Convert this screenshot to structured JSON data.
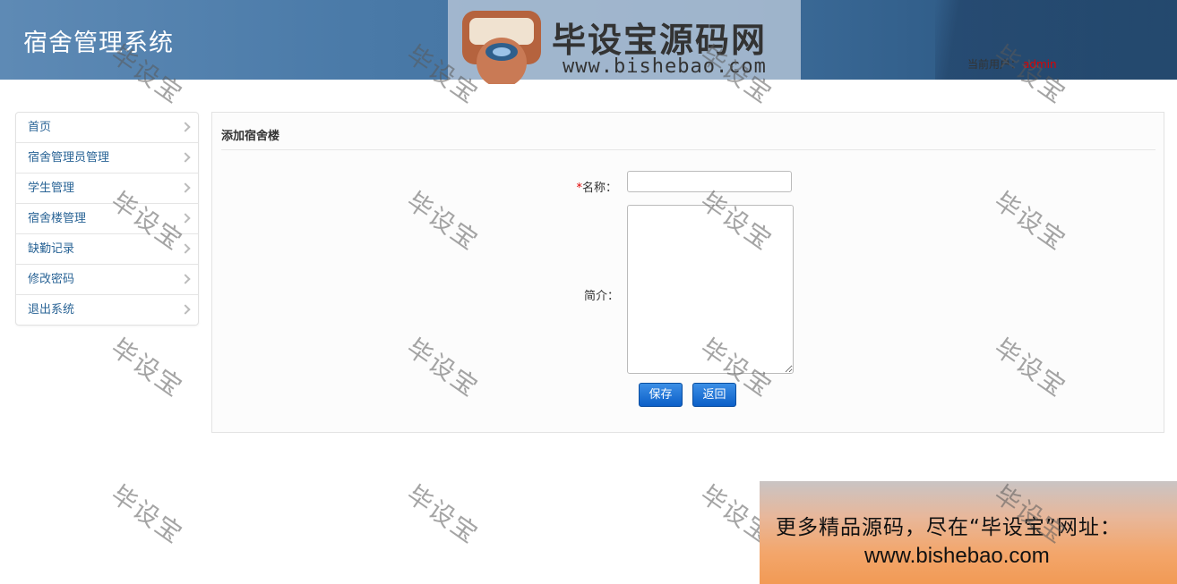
{
  "header": {
    "app_title": "宿舍管理系统",
    "user_label": "当前用户：",
    "user_name": "admin"
  },
  "logo": {
    "name": "毕设宝源码网",
    "url": "www.bishebao.com"
  },
  "sidebar": {
    "items": [
      {
        "label": "首页"
      },
      {
        "label": "宿舍管理员管理"
      },
      {
        "label": "学生管理"
      },
      {
        "label": "宿舍楼管理"
      },
      {
        "label": "缺勤记录"
      },
      {
        "label": "修改密码"
      },
      {
        "label": "退出系统"
      }
    ]
  },
  "form": {
    "title": "添加宿舍楼",
    "required_mark": "*",
    "name_label": "名称：",
    "name_value": "",
    "intro_label": "简介：",
    "intro_value": "",
    "save_label": "保存",
    "back_label": "返回"
  },
  "watermark": {
    "text": "毕设宝"
  },
  "ad": {
    "line1": "更多精品源码，尽在“毕设宝”网址：",
    "line2": "www.bishebao.com"
  },
  "colors": {
    "header_bg": "#4a7aa8",
    "link": "#2a6496",
    "required": "#e00000",
    "button": "#0c5fc8"
  }
}
